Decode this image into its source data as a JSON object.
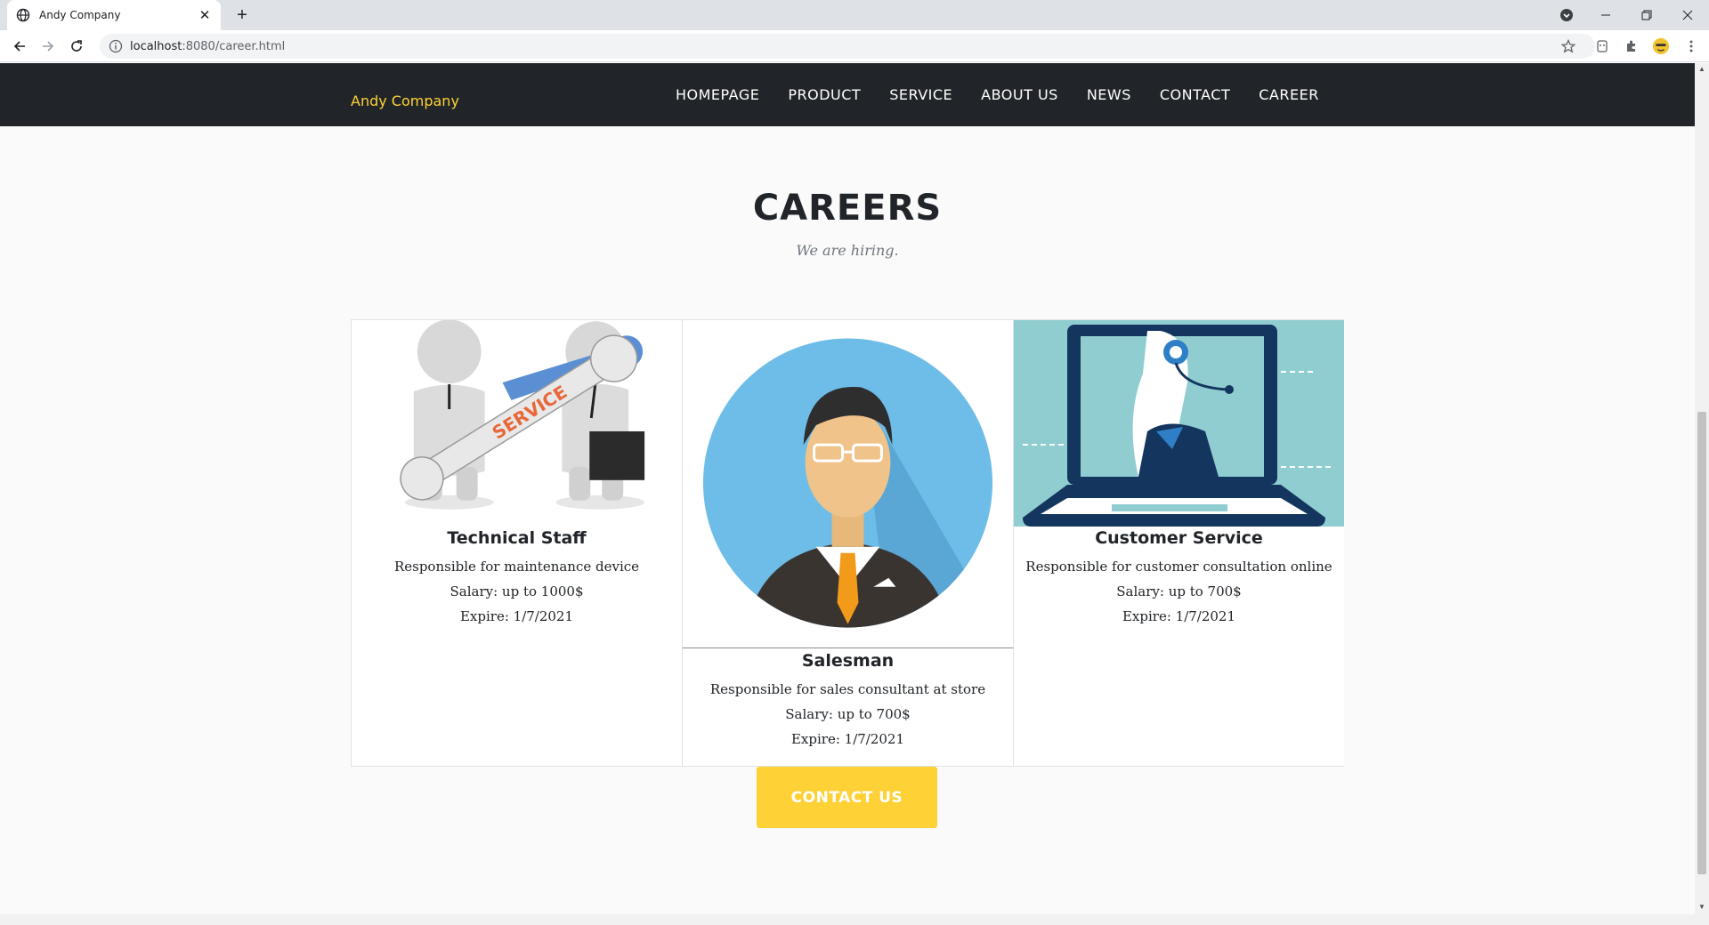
{
  "browser": {
    "tab_title": "Andy Company",
    "url_host": "localhost",
    "url_path": ":8080/career.html"
  },
  "site": {
    "brand": "Andy Company",
    "nav": [
      "HOMEPAGE",
      "PRODUCT",
      "SERVICE",
      "ABOUT US",
      "NEWS",
      "CONTACT",
      "CAREER"
    ]
  },
  "page": {
    "heading": "CAREERS",
    "subheading": "We are hiring."
  },
  "jobs": [
    {
      "title": "Technical Staff",
      "description": "Responsible for maintenance device",
      "salary": "Salary: up to 1000$",
      "expire": "Expire: 1/7/2021",
      "image_label": "SERVICE"
    },
    {
      "title": "Salesman",
      "description": "Responsible for sales consultant at store",
      "salary": "Salary: up to 700$",
      "expire": "Expire: 1/7/2021"
    },
    {
      "title": "Customer Service",
      "description": "Responsible for customer consultation online",
      "salary": "Salary: up to 700$",
      "expire": "Expire: 1/7/2021"
    }
  ],
  "cta": {
    "label": "CONTACT US"
  },
  "colors": {
    "accent": "#fed136",
    "nav_bg": "#212529"
  },
  "icons": [
    "globe-icon",
    "close-icon",
    "plus-icon",
    "back-icon",
    "forward-icon",
    "reload-icon",
    "info-icon",
    "star-icon",
    "extension-icon",
    "profile-icon",
    "menu-icon",
    "minimize-icon",
    "restore-icon"
  ]
}
